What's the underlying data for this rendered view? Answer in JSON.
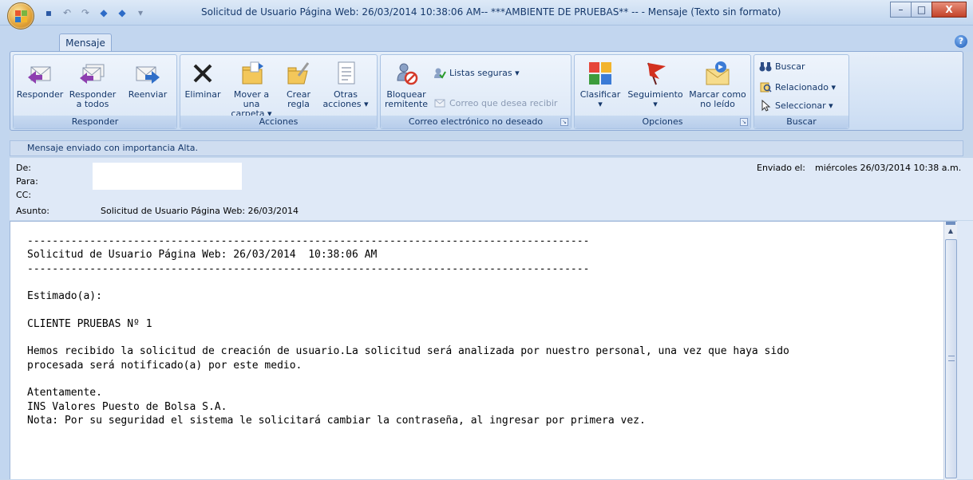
{
  "window": {
    "title": "Solicitud de Usuario Página Web: 26/03/2014  10:38:06 AM-- ***AMBIENTE DE PRUEBAS** -- - Mensaje (Texto sin formato)",
    "minimize": "–",
    "maximize": "□",
    "close": "X"
  },
  "quick_access": [
    "save-icon",
    "undo-icon",
    "redo-icon",
    "previous-icon",
    "next-icon",
    "customize-icon"
  ],
  "tabs": [
    {
      "label": "Mensaje"
    }
  ],
  "ribbon": {
    "groups": {
      "responder": {
        "label": "Responder",
        "buttons": {
          "reply": "Responder",
          "reply_all_1": "Responder",
          "reply_all_2": "a todos",
          "forward": "Reenviar"
        }
      },
      "acciones": {
        "label": "Acciones",
        "buttons": {
          "delete": "Eliminar",
          "move_1": "Mover a una",
          "move_2": "carpeta ▾",
          "rule_1": "Crear",
          "rule_2": "regla",
          "other_1": "Otras",
          "other_2": "acciones ▾"
        }
      },
      "junk": {
        "label": "Correo electrónico no deseado",
        "buttons": {
          "block_1": "Bloquear",
          "block_2": "remitente",
          "safe_lists": "Listas seguras ▾",
          "wanted": "Correo que desea recibir"
        }
      },
      "opciones": {
        "label": "Opciones",
        "buttons": {
          "categorize": "Clasificar",
          "followup": "Seguimiento",
          "mark_unread_1": "Marcar como",
          "mark_unread_2": "no leído",
          "dropdown_mark": "▾"
        }
      },
      "buscar": {
        "label": "Buscar",
        "buttons": {
          "find": "Buscar",
          "related": "Relacionado ▾",
          "select": "Seleccionar ▾"
        }
      }
    }
  },
  "message": {
    "importance_info": "Mensaje enviado con importancia Alta.",
    "labels": {
      "from": "De:",
      "to": "Para:",
      "cc": "CC:",
      "subject": "Asunto:",
      "sent": "Enviado el:"
    },
    "sent_value": "miércoles 26/03/2014 10:38 a.m.",
    "subject_value": "Solicitud de Usuario Página Web: 26/03/2014",
    "body": "------------------------------------------------------------------------------------------\nSolicitud de Usuario Página Web: 26/03/2014  10:38:06 AM\n------------------------------------------------------------------------------------------\n\nEstimado(a):\n\nCLIENTE PRUEBAS Nº 1\n\nHemos recibido la solicitud de creación de usuario.La solicitud será analizada por nuestro personal, una vez que haya sido\nprocesada será notificado(a) por este medio.\n\nAtentamente.\nINS Valores Puesto de Bolsa S.A.\nNota: Por su seguridad el sistema le solicitará cambiar la contraseña, al ingresar por primera vez."
  },
  "colors": {
    "title_text": "#15386b",
    "ribbon_bg": "#dbe7f6",
    "header_bg": "#dfe9f7"
  }
}
